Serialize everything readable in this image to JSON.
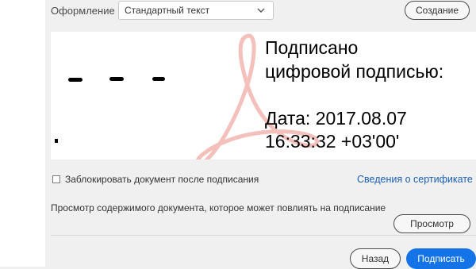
{
  "appearance": {
    "label": "Оформление",
    "selected": "Стандартный текст",
    "create_label": "Создание"
  },
  "signature_preview": {
    "line1": "Подписано",
    "line2": "цифровой подписью:",
    "line3": "Дата: 2017.08.07",
    "line4": "16:33:32 +03'00'"
  },
  "options": {
    "lock_label": "Заблокировать документ после подписания",
    "lock_checked": false,
    "certificate_link": "Сведения о сертификате"
  },
  "preview_section": {
    "note": "Просмотр содержимого документа, которое может повлиять на подписание",
    "button_label": "Просмотр"
  },
  "footer": {
    "back_label": "Назад",
    "sign_label": "Подписать"
  },
  "colors": {
    "accent": "#1473e6",
    "link": "#1a5fb4",
    "watermark": "#f3c0bc"
  }
}
